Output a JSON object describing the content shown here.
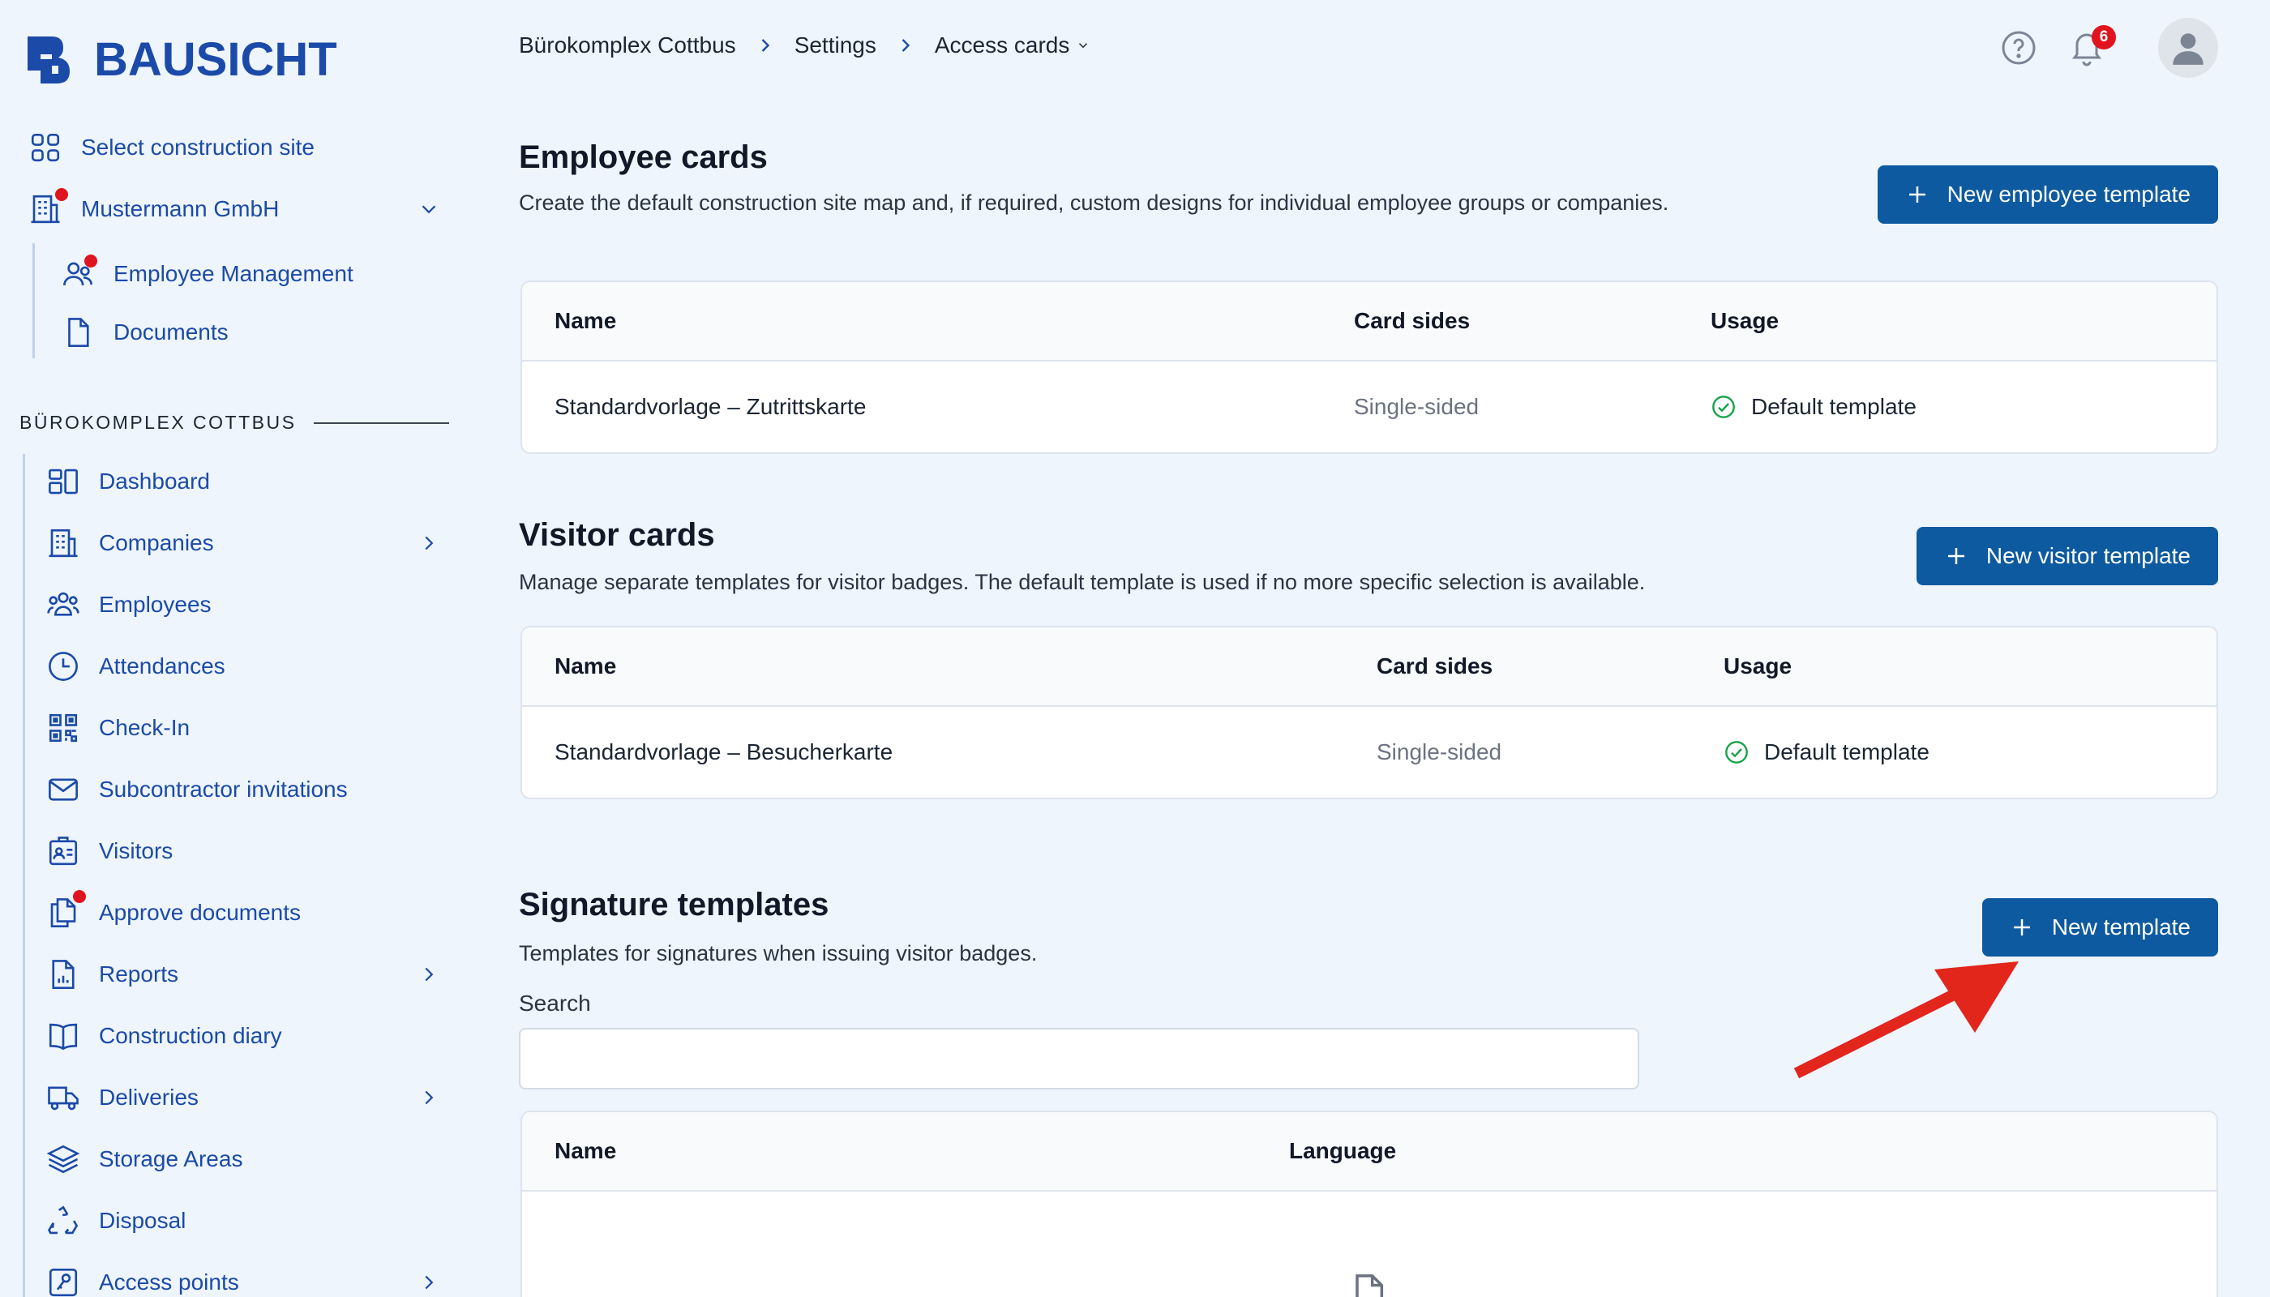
{
  "app": {
    "brand": "BAUSICHT",
    "accent": "#1b4aa8",
    "button_color": "#0d5aa0",
    "alert_color": "#e0141e"
  },
  "sidebar": {
    "select_site": "Select construction site",
    "company": "Mustermann GmbH",
    "company_items": [
      {
        "label": "Employee Management",
        "icon": "users-icon",
        "notify": true
      },
      {
        "label": "Documents",
        "icon": "document-icon"
      }
    ],
    "section": "BÜROKOMPLEX COTTBUS",
    "items": [
      {
        "label": "Dashboard",
        "icon": "dashboard-icon"
      },
      {
        "label": "Companies",
        "icon": "building-icon",
        "chevron": true
      },
      {
        "label": "Employees",
        "icon": "employees-icon"
      },
      {
        "label": "Attendances",
        "icon": "clock-icon"
      },
      {
        "label": "Check-In",
        "icon": "qr-code-icon"
      },
      {
        "label": "Subcontractor invitations",
        "icon": "mail-icon"
      },
      {
        "label": "Visitors",
        "icon": "visitor-badge-icon"
      },
      {
        "label": "Approve documents",
        "icon": "documents-icon",
        "notify": true
      },
      {
        "label": "Reports",
        "icon": "report-icon",
        "chevron": true
      },
      {
        "label": "Construction diary",
        "icon": "book-icon"
      },
      {
        "label": "Deliveries",
        "icon": "truck-icon",
        "chevron": true
      },
      {
        "label": "Storage Areas",
        "icon": "layers-icon"
      },
      {
        "label": "Disposal",
        "icon": "recycle-icon"
      },
      {
        "label": "Access points",
        "icon": "access-point-icon",
        "chevron": true
      }
    ]
  },
  "header": {
    "breadcrumb": [
      "Bürokomplex Cottbus",
      "Settings",
      "Access cards"
    ],
    "notifications": "6"
  },
  "employee_cards": {
    "title": "Employee cards",
    "description": "Create the default construction site map and, if required, custom designs for individual employee groups or companies.",
    "button": "New employee template",
    "columns": [
      "Name",
      "Card sides",
      "Usage"
    ],
    "rows": [
      {
        "name": "Standardvorlage – Zutrittskarte",
        "sides": "Single-sided",
        "usage": "Default template"
      }
    ]
  },
  "visitor_cards": {
    "title": "Visitor cards",
    "description": "Manage separate templates for visitor badges. The default template is used if no more specific selection is available.",
    "button": "New visitor template",
    "columns": [
      "Name",
      "Card sides",
      "Usage"
    ],
    "rows": [
      {
        "name": "Standardvorlage – Besucherkarte",
        "sides": "Single-sided",
        "usage": "Default template"
      }
    ]
  },
  "signature_templates": {
    "title": "Signature templates",
    "description": "Templates for signatures when issuing visitor badges.",
    "button": "New template",
    "search_label": "Search",
    "search_value": "",
    "columns": [
      "Name",
      "Language"
    ]
  }
}
